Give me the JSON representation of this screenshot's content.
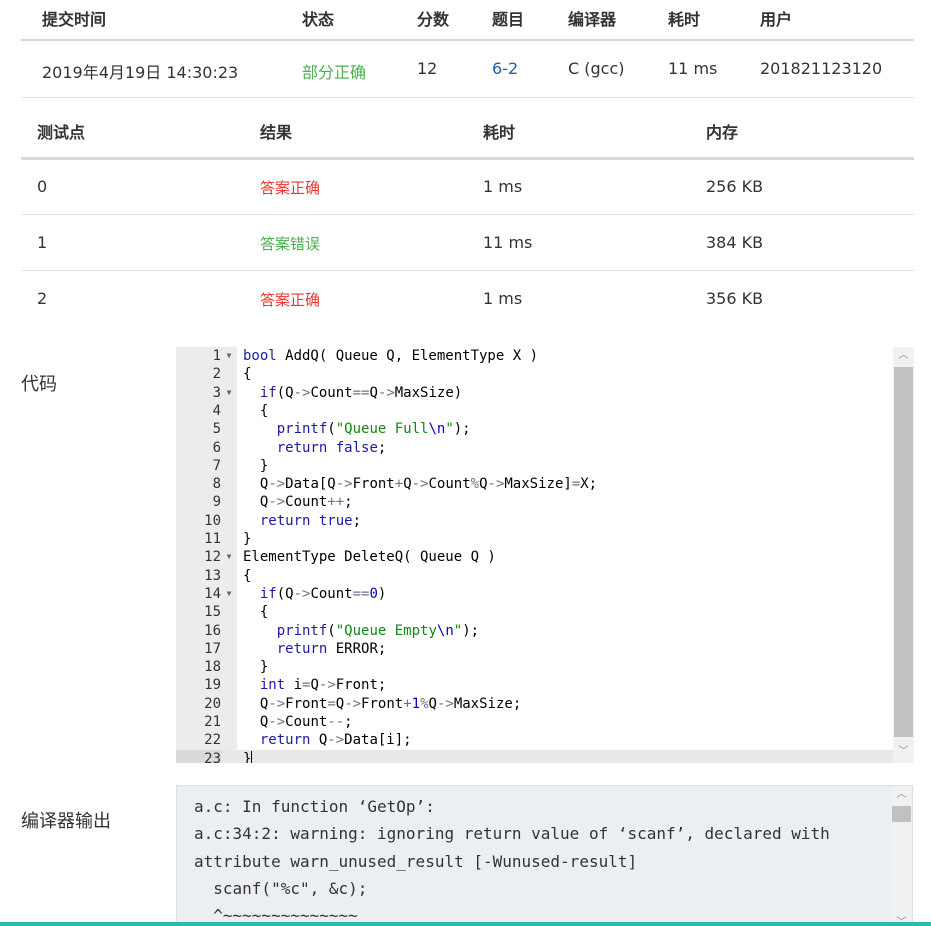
{
  "submission": {
    "headers": [
      "提交时间",
      "状态",
      "分数",
      "题目",
      "编译器",
      "耗时",
      "用户"
    ],
    "row": {
      "time": "2019年4月19日 14:30:23",
      "status": "部分正确",
      "score": "12",
      "problem": "6-2",
      "compiler": "C (gcc)",
      "elapsed": "11 ms",
      "user": "201821123120"
    }
  },
  "tests": {
    "headers": [
      "测试点",
      "结果",
      "耗时",
      "内存"
    ],
    "rows": [
      {
        "id": "0",
        "result": "答案正确",
        "time": "1 ms",
        "memory": "256 KB"
      },
      {
        "id": "1",
        "result": "答案错误",
        "time": "11 ms",
        "memory": "384 KB"
      },
      {
        "id": "2",
        "result": "答案正确",
        "time": "1 ms",
        "memory": "356 KB"
      }
    ]
  },
  "code_label": "代码",
  "code": {
    "line_numbers": [
      "1",
      "2",
      "3",
      "4",
      "5",
      "6",
      "7",
      "8",
      "9",
      "10",
      "11",
      "12",
      "13",
      "14",
      "15",
      "16",
      "17",
      "18",
      "19",
      "20",
      "21",
      "22",
      "23"
    ],
    "lines": [
      "bool AddQ( Queue Q, ElementType X )",
      "{",
      "  if(Q->Count==Q->MaxSize)",
      "  {",
      "    printf(\"Queue Full\\n\");",
      "    return false;",
      "  }",
      "  Q->Data[Q->Front+Q->Count%Q->MaxSize]=X;",
      "  Q->Count++;",
      "  return true;",
      "}",
      "ElementType DeleteQ( Queue Q )",
      "{",
      "  if(Q->Count==0)",
      "  {",
      "    printf(\"Queue Empty\\n\");",
      "    return ERROR;",
      "  }",
      "  int i=Q->Front;",
      "  Q->Front=Q->Front+1%Q->MaxSize;",
      "  Q->Count--;",
      "  return Q->Data[i];",
      "}"
    ]
  },
  "compiler_output_label": "编译器输出",
  "compiler_output": [
    "a.c: In function ‘GetOp’:",
    "a.c:34:2: warning: ignoring return value of ‘scanf’, declared with",
    "attribute warn_unused_result [-Wunused-result]",
    "  scanf(\"%c\", &c);",
    "  ^~~~~~~~~~~~~~~"
  ],
  "colors": {
    "correct": "#e53935",
    "wrong": "#4caf50",
    "partial": "#4caf50",
    "link": "#1f5eaa",
    "accent_bar": "#2bbbad"
  }
}
